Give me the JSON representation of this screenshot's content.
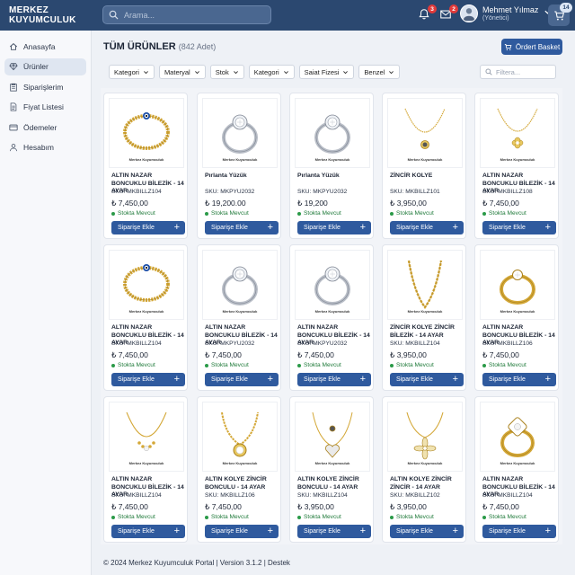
{
  "header": {
    "brand_line1": "MERKEZ",
    "brand_line2": "KUYUMCULUK",
    "search_placeholder": "Arama...",
    "notifications_count": "3",
    "messages_count": "2",
    "user_name": "Mehmet Yılmaz",
    "user_role": "(Yönetici)",
    "cart_count": "14"
  },
  "sidebar": {
    "items": [
      {
        "label": "Anasayfa",
        "icon": "home-icon"
      },
      {
        "label": "Ürünler",
        "icon": "diamond-icon",
        "active": true
      },
      {
        "label": "Siparişlerim",
        "icon": "clipboard-icon"
      },
      {
        "label": "Fiyat Listesi",
        "icon": "document-icon"
      },
      {
        "label": "Ödemeler",
        "icon": "credit-card-icon"
      },
      {
        "label": "Hesabım",
        "icon": "user-icon"
      }
    ]
  },
  "main": {
    "title": "TÜM ÜRÜNLER",
    "count": "(842 Adet)",
    "order_button": "Ördert Basket",
    "filters": [
      "Kategori",
      "Materyal",
      "Stok",
      "Kategori",
      "Saiat Fizesi",
      "Benzel"
    ],
    "filter_placeholder": "Filtera..."
  },
  "watermark": "Merkez Kuyumculuk",
  "products": [
    {
      "name": "ALTIN NAZAR BONCUKLU BİLEZİK - 14 AYAR",
      "sku": "SKU: MKBILLZ104",
      "price": "₺ 7,450,00",
      "stock": "Stokta Mevcut",
      "add": "Siparişe Ekle",
      "image": "gold-bracelet-evil-eye"
    },
    {
      "name": "Pırlanta Yüzük",
      "sku": "SKU: MKPYU2032",
      "price": "₺ 19,200.00",
      "stock": "Stokta Mevcut",
      "add": "Siparişe Ekle",
      "image": "diamond-ring"
    },
    {
      "name": "Pırlanta Yüzük",
      "sku": "SKU: MKPYU2032",
      "price": "₺ 19,200",
      "stock": "Stokta Mevcut",
      "add": "Siparişe Ekle",
      "image": "diamond-ring"
    },
    {
      "name": "ZİNCİR KOLYE",
      "sku": "SKU: MKBILLZ101",
      "price": "₺ 3,950,00",
      "stock": "Stokta Mevcut",
      "add": "Siparişe Ekle",
      "image": "gold-necklace-pendant"
    },
    {
      "name": "ALTIN NAZAR BONCUKLU BİLEZİK - 14 AYAR",
      "sku": "SKU: MKBILLZ108",
      "price": "₺ 7,450,00",
      "stock": "Stokta Mevcut",
      "add": "Siparişe Ekle",
      "image": "gold-necklace-clover"
    },
    {
      "name": "ALTIN NAZAR BONCUKLU BİLEZİK - 14 AYAR",
      "sku": "SKU: MKBILLZ104",
      "price": "₺ 7,450,00",
      "stock": "Stokta Mevcut",
      "add": "Siparişe Ekle",
      "image": "gold-bracelet-evil-eye"
    },
    {
      "name": "ALTIN NAZAR BONCUKLU BİLEZİK - 14 AYAR",
      "sku": "SKU: MKPYU2032",
      "price": "₺ 7,450,00",
      "stock": "Stokta Mevcut",
      "add": "Siparişe Ekle",
      "image": "diamond-ring"
    },
    {
      "name": "ALTIN NAZAR BONCUKLU BİLEZİK - 14 AYAR",
      "sku": "SKU: MKPYU2032",
      "price": "₺ 7,450,00",
      "stock": "Stokta Mevcut",
      "add": "Siparişe Ekle",
      "image": "diamond-ring"
    },
    {
      "name": "ZİNCİR KOLYE ZİNCİR BİLEZİK - 14 AYAR",
      "sku": "SKU: MKBILLZ104",
      "price": "₺ 3,950,00",
      "stock": "Stokta Mevcut",
      "add": "Siparişe Ekle",
      "image": "gold-chain"
    },
    {
      "name": "ALTIN NAZAR BONCUKLU BİLEZİK - 14 AYAR",
      "sku": "SKU: MKBILLZ106",
      "price": "₺ 7,450,00",
      "stock": "Stokta Mevcut",
      "add": "Siparişe Ekle",
      "image": "gold-ring-solitaire"
    },
    {
      "name": "ALTIN NAZAR BONCUKLU BİLEZİK - 14 AYAR",
      "sku": "SKU: MKBILLZ104",
      "price": "₺ 7,450,00",
      "stock": "Stokta Mevcut",
      "add": "Siparişe Ekle",
      "image": "gold-necklace-beads"
    },
    {
      "name": "ALTIN KOLYE ZİNCİR BONCULU - 14 AYAR",
      "sku": "SKU: MKBILLZ106",
      "price": "₺ 7,450,00",
      "stock": "Stokta Mevcut",
      "add": "Siparişe Ekle",
      "image": "gold-necklace-round"
    },
    {
      "name": "ALTIN KOLYE ZİNCİR BONCULU - 14 AYAR",
      "sku": "SKU: MKBILLZ104",
      "price": "₺ 3,950,00",
      "stock": "Stokta Mevcut",
      "add": "Siparişe Ekle",
      "image": "gold-necklace-heart"
    },
    {
      "name": "ALTIN KOLYE ZİNCİR ZİNCİR - 14 AYAR",
      "sku": "SKU: MKBILLZ102",
      "price": "₺ 3,950,00",
      "stock": "Stokta Mevcut",
      "add": "Siparişe Ekle",
      "image": "gold-necklace-flower"
    },
    {
      "name": "ALTIN NAZAR BONCUKLU BİLEZİK - 14 AYAR",
      "sku": "SKU: MKBILLZ104",
      "price": "₺ 7,450,00",
      "stock": "Stokta Mevcut",
      "add": "Siparişe Ekle",
      "image": "gold-ring-halo"
    }
  ],
  "footer": "© 2024 Merkez Kuyumculuk Portal | Version 3.1.2 | Destek"
}
